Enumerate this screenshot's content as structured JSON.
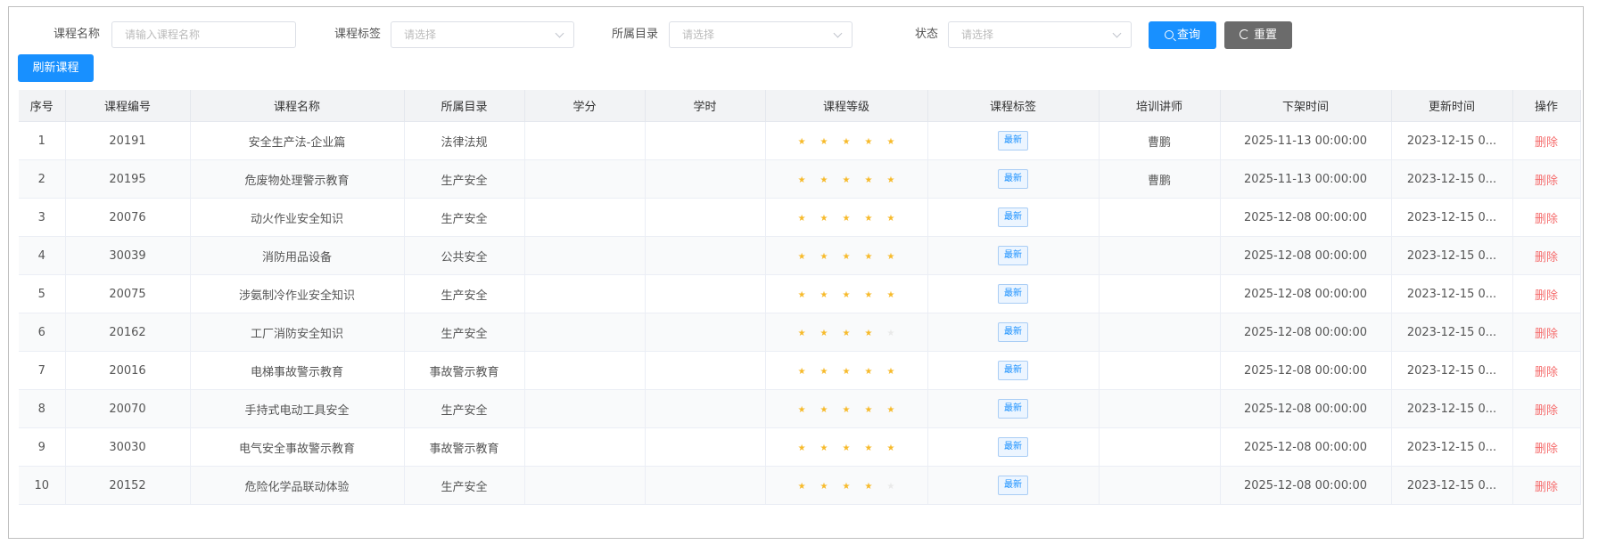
{
  "filters": {
    "course_name": {
      "label": "课程名称",
      "placeholder": "请输入课程名称"
    },
    "course_tag": {
      "label": "课程标签",
      "placeholder": "请选择"
    },
    "directory": {
      "label": "所属目录",
      "placeholder": "请选择"
    },
    "status": {
      "label": "状态",
      "placeholder": "请选择"
    },
    "query_label": "查询",
    "reset_label": "重置"
  },
  "refresh_label": "刷新课程",
  "table": {
    "headers": [
      "序号",
      "课程编号",
      "课程名称",
      "所属目录",
      "学分",
      "学时",
      "课程等级",
      "课程标签",
      "培训讲师",
      "下架时间",
      "更新时间",
      "操作"
    ],
    "rows": [
      {
        "index": "1",
        "code": "20191",
        "name": "安全生产法-企业篇",
        "dir": "法律法规",
        "credit": "",
        "hours": "",
        "level": 5,
        "tag": "最新",
        "teacher": "曹鹏",
        "offline": "2025-11-13 00:00:00",
        "updated": "2023-12-15 0...",
        "action": "删除"
      },
      {
        "index": "2",
        "code": "20195",
        "name": "危废物处理警示教育",
        "dir": "生产安全",
        "credit": "",
        "hours": "",
        "level": 5,
        "tag": "最新",
        "teacher": "曹鹏",
        "offline": "2025-11-13 00:00:00",
        "updated": "2023-12-15 0...",
        "action": "删除"
      },
      {
        "index": "3",
        "code": "20076",
        "name": "动火作业安全知识",
        "dir": "生产安全",
        "credit": "",
        "hours": "",
        "level": 5,
        "tag": "最新",
        "teacher": "",
        "offline": "2025-12-08 00:00:00",
        "updated": "2023-12-15 0...",
        "action": "删除"
      },
      {
        "index": "4",
        "code": "30039",
        "name": "消防用品设备",
        "dir": "公共安全",
        "credit": "",
        "hours": "",
        "level": 5,
        "tag": "最新",
        "teacher": "",
        "offline": "2025-12-08 00:00:00",
        "updated": "2023-12-15 0...",
        "action": "删除"
      },
      {
        "index": "5",
        "code": "20075",
        "name": "涉氨制冷作业安全知识",
        "dir": "生产安全",
        "credit": "",
        "hours": "",
        "level": 5,
        "tag": "最新",
        "teacher": "",
        "offline": "2025-12-08 00:00:00",
        "updated": "2023-12-15 0...",
        "action": "删除"
      },
      {
        "index": "6",
        "code": "20162",
        "name": "工厂消防安全知识",
        "dir": "生产安全",
        "credit": "",
        "hours": "",
        "level": 4,
        "tag": "最新",
        "teacher": "",
        "offline": "2025-12-08 00:00:00",
        "updated": "2023-12-15 0...",
        "action": "删除"
      },
      {
        "index": "7",
        "code": "20016",
        "name": "电梯事故警示教育",
        "dir": "事故警示教育",
        "credit": "",
        "hours": "",
        "level": 5,
        "tag": "最新",
        "teacher": "",
        "offline": "2025-12-08 00:00:00",
        "updated": "2023-12-15 0...",
        "action": "删除"
      },
      {
        "index": "8",
        "code": "20070",
        "name": "手持式电动工具安全",
        "dir": "生产安全",
        "credit": "",
        "hours": "",
        "level": 5,
        "tag": "最新",
        "teacher": "",
        "offline": "2025-12-08 00:00:00",
        "updated": "2023-12-15 0...",
        "action": "删除"
      },
      {
        "index": "9",
        "code": "30030",
        "name": "电气安全事故警示教育",
        "dir": "事故警示教育",
        "credit": "",
        "hours": "",
        "level": 5,
        "tag": "最新",
        "teacher": "",
        "offline": "2025-12-08 00:00:00",
        "updated": "2023-12-15 0...",
        "action": "删除"
      },
      {
        "index": "10",
        "code": "20152",
        "name": "危险化学品联动体验",
        "dir": "生产安全",
        "credit": "",
        "hours": "",
        "level": 4,
        "tag": "最新",
        "teacher": "",
        "offline": "2025-12-08 00:00:00",
        "updated": "2023-12-15 0...",
        "action": "删除"
      }
    ],
    "max_level": 5
  },
  "colors": {
    "primary": "#1890ff",
    "star_on": "#f7ba2a",
    "star_off": "#e9e9e9",
    "danger": "#f56c6c",
    "reset": "#6b6b6b"
  }
}
